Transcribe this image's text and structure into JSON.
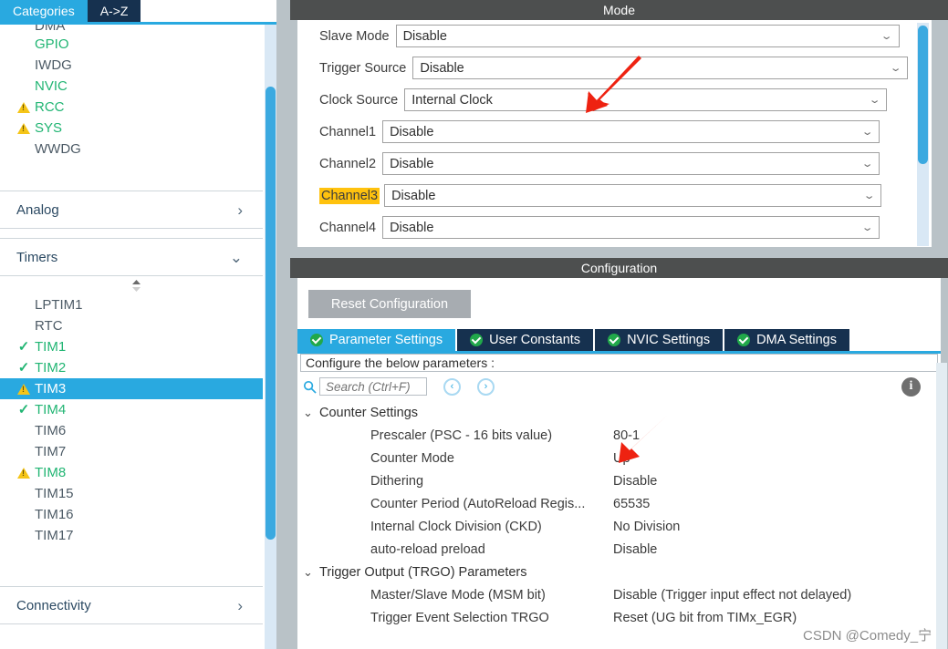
{
  "left_panel": {
    "tabs": [
      {
        "label": "Categories",
        "active": true
      },
      {
        "label": "A->Z",
        "active": false
      }
    ],
    "clipped_top_item": "DMA",
    "peripherals": [
      {
        "label": "GPIO",
        "state": "ok"
      },
      {
        "label": "IWDG",
        "state": "plain"
      },
      {
        "label": "NVIC",
        "state": "ok"
      },
      {
        "label": "RCC",
        "state": "warn"
      },
      {
        "label": "SYS",
        "state": "warn"
      },
      {
        "label": "WWDG",
        "state": "plain"
      }
    ],
    "group_analog": {
      "label": "Analog",
      "chevron": "chevron-right-icon"
    },
    "group_timers": {
      "label": "Timers",
      "chevron": "chevron-down-icon"
    },
    "timers": [
      {
        "label": "LPTIM1",
        "state": "plain",
        "selected": false
      },
      {
        "label": "RTC",
        "state": "plain",
        "selected": false
      },
      {
        "label": "TIM1",
        "state": "ok",
        "selected": false
      },
      {
        "label": "TIM2",
        "state": "ok",
        "selected": false
      },
      {
        "label": "TIM3",
        "state": "warn",
        "selected": true
      },
      {
        "label": "TIM4",
        "state": "ok",
        "selected": false
      },
      {
        "label": "TIM6",
        "state": "plain",
        "selected": false
      },
      {
        "label": "TIM7",
        "state": "plain",
        "selected": false
      },
      {
        "label": "TIM8",
        "state": "warn",
        "selected": false
      },
      {
        "label": "TIM15",
        "state": "plain",
        "selected": false
      },
      {
        "label": "TIM16",
        "state": "plain",
        "selected": false
      },
      {
        "label": "TIM17",
        "state": "plain",
        "selected": false
      }
    ],
    "group_connectivity": {
      "label": "Connectivity",
      "chevron": "chevron-right-icon"
    }
  },
  "mode": {
    "title": "Mode",
    "rows": [
      {
        "label": "Slave Mode",
        "value": "Disable",
        "width": "w-slave",
        "highlight": false
      },
      {
        "label": "Trigger Source",
        "value": "Disable",
        "width": "w-trigger",
        "highlight": false
      },
      {
        "label": "Clock Source",
        "value": "Internal Clock",
        "width": "w-clock",
        "highlight": false
      },
      {
        "label": "Channel1",
        "value": "Disable",
        "width": "w-chan",
        "highlight": false
      },
      {
        "label": "Channel2",
        "value": "Disable",
        "width": "w-chan",
        "highlight": false
      },
      {
        "label": "Channel3",
        "value": "Disable",
        "width": "w-chan",
        "highlight": true
      },
      {
        "label": "Channel4",
        "value": "Disable",
        "width": "w-chan",
        "highlight": false
      }
    ]
  },
  "configuration": {
    "title": "Configuration",
    "reset_button": "Reset Configuration",
    "tabs": [
      {
        "label": "Parameter Settings",
        "active": true
      },
      {
        "label": "User Constants",
        "active": false
      },
      {
        "label": "NVIC Settings",
        "active": false
      },
      {
        "label": "DMA Settings",
        "active": false
      }
    ],
    "configure_hint": "Configure the below parameters :",
    "search_placeholder": "Search (Ctrl+F)",
    "search_value": "",
    "prev_label": "‹",
    "next_label": "›",
    "info_label": "i",
    "groups": [
      {
        "label": "Counter Settings",
        "expanded": true,
        "params": [
          {
            "name": "Prescaler (PSC - 16 bits value)",
            "value": "80-1"
          },
          {
            "name": "Counter Mode",
            "value": "Up"
          },
          {
            "name": "Dithering",
            "value": "Disable"
          },
          {
            "name": "Counter Period (AutoReload Regis...",
            "value": "65535"
          },
          {
            "name": "Internal Clock Division (CKD)",
            "value": "No Division"
          },
          {
            "name": "auto-reload preload",
            "value": "Disable"
          }
        ]
      },
      {
        "label": "Trigger Output (TRGO) Parameters",
        "expanded": true,
        "params": [
          {
            "name": "Master/Slave Mode (MSM bit)",
            "value": "Disable (Trigger input effect not delayed)"
          },
          {
            "name": "Trigger Event Selection TRGO",
            "value": "Reset (UG bit from TIMx_EGR)"
          }
        ]
      }
    ]
  },
  "annotations": {
    "watermark": "CSDN @Comedy_宁",
    "arrow_color": "#ee2211"
  }
}
